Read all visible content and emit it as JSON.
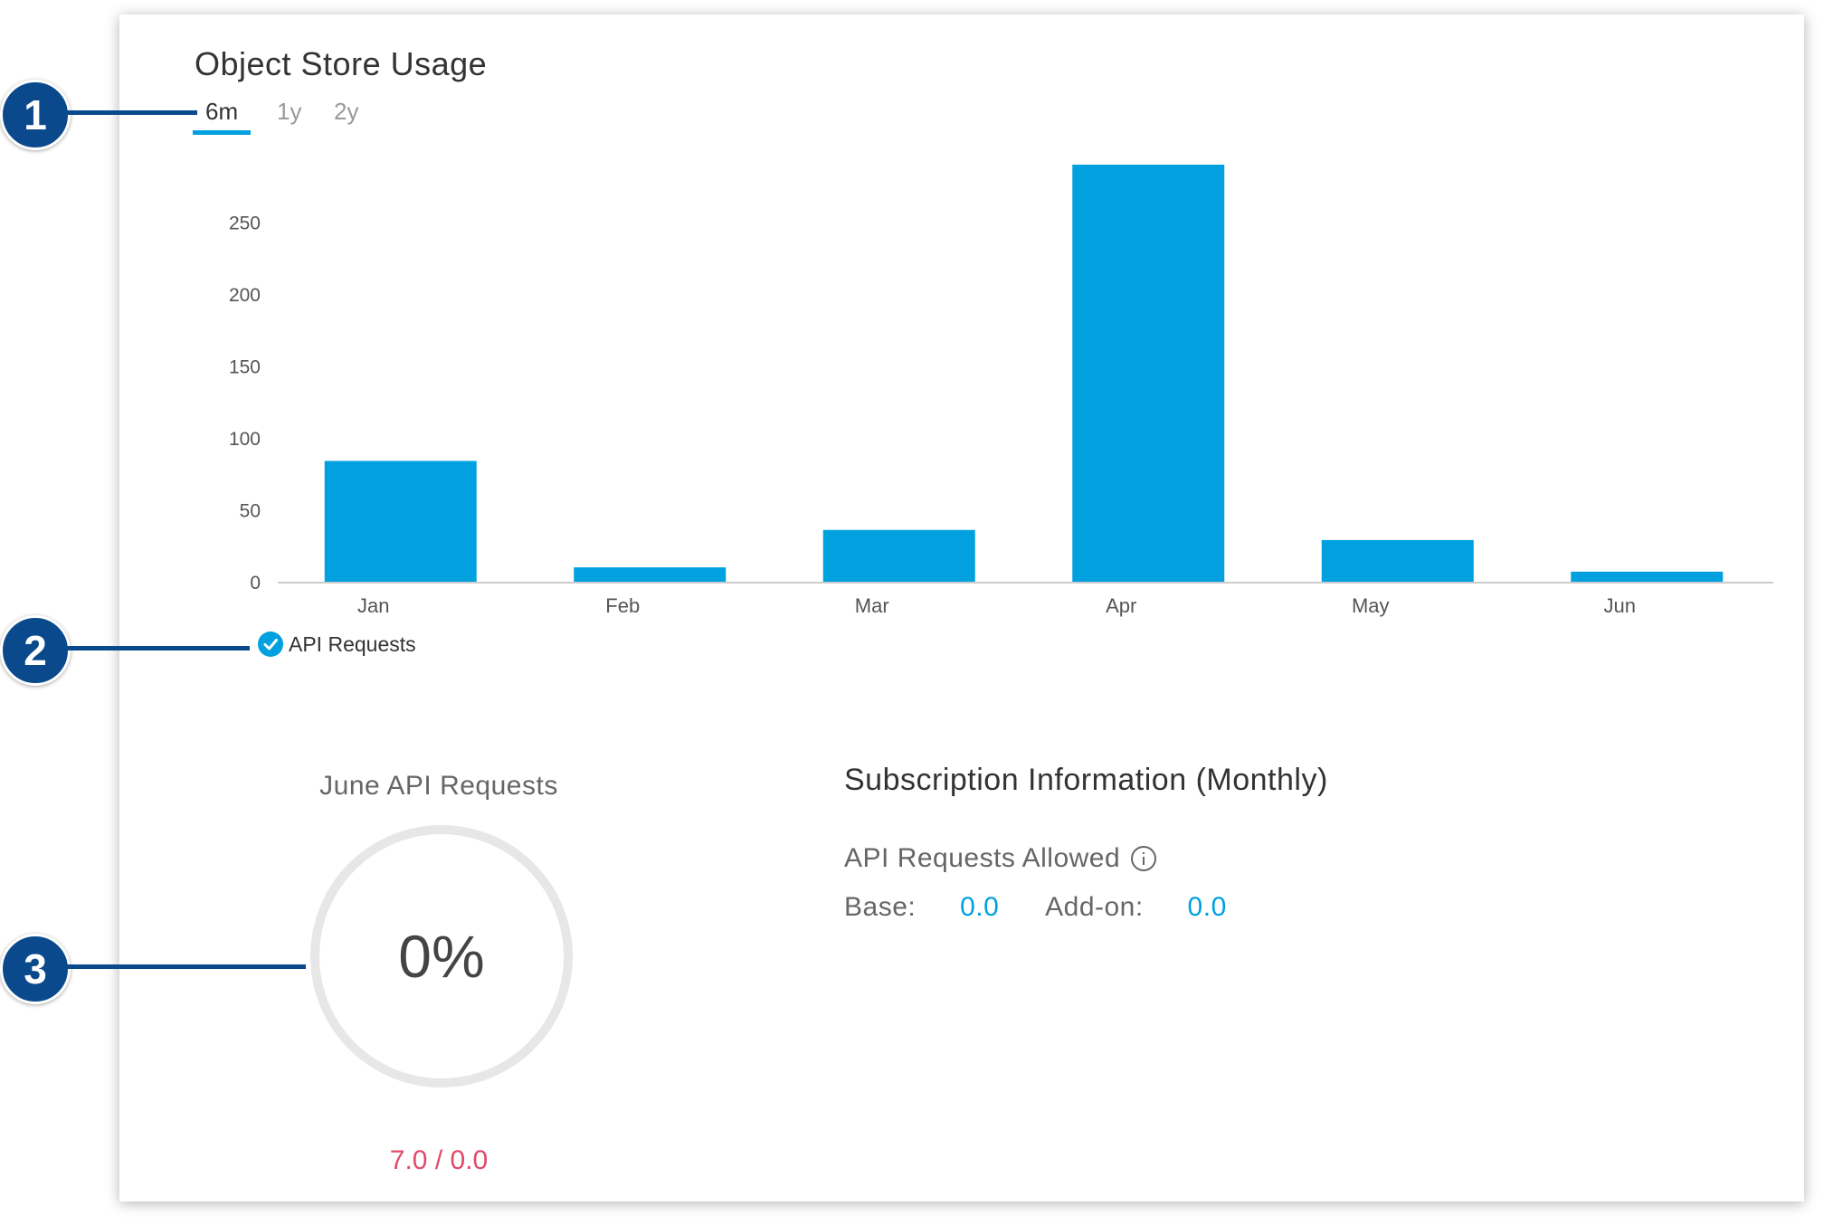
{
  "card": {
    "title": "Object Store Usage",
    "tabs": [
      {
        "label": "6m",
        "active": true
      },
      {
        "label": "1y",
        "active": false
      },
      {
        "label": "2y",
        "active": false
      }
    ]
  },
  "chart_data": {
    "type": "bar",
    "categories": [
      "Jan",
      "Feb",
      "Mar",
      "Apr",
      "May",
      "Jun"
    ],
    "series": [
      {
        "name": "API Requests",
        "values": [
          84,
          10,
          36,
          290,
          29,
          7
        ]
      }
    ],
    "ylim": [
      0,
      290
    ],
    "yticks": [
      0,
      50,
      100,
      150,
      200,
      250
    ],
    "color": "#00a1de",
    "grid": false,
    "legend": "bottom-left"
  },
  "legend": {
    "label": "API Requests"
  },
  "callouts": [
    "1",
    "2",
    "3"
  ],
  "usage": {
    "title": "June API Requests",
    "percent": "0%",
    "ratio": "7.0 / 0.0"
  },
  "subscription": {
    "title": "Subscription Information (Monthly)",
    "section_label": "API Requests Allowed",
    "base_label": "Base:",
    "base_value": "0.0",
    "addon_label": "Add-on:",
    "addon_value": "0.0"
  },
  "colors": {
    "accent": "#00a1de",
    "callout": "#0a4a8c",
    "ratio": "#e04a6a"
  }
}
